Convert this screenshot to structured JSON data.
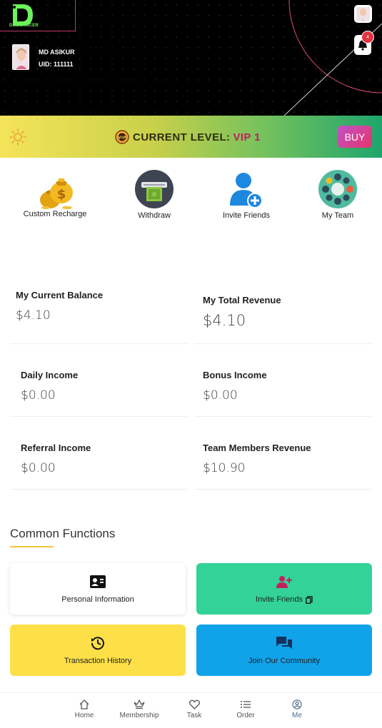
{
  "header": {
    "logo_text": "DUOLANCER",
    "user_name": "MD ASIKUR",
    "user_uid": "UID: 111111",
    "notification_count": "4"
  },
  "level": {
    "label": "CURRENT LEVEL:",
    "value": "VIP 1",
    "buy_label": "BUY",
    "colors": {
      "bar_start": "#f5e45a",
      "bar_end": "#1ea56c",
      "vip_text": "#c0215d",
      "buy_start": "#c052c9",
      "buy_end": "#e6356a"
    }
  },
  "quick_actions": [
    {
      "label": "Custom Recharge",
      "icon": "money-bags-icon"
    },
    {
      "label": "Withdraw",
      "icon": "cash-machine-icon"
    },
    {
      "label": "Invite Friends",
      "icon": "add-user-icon"
    },
    {
      "label": "My Team",
      "icon": "team-table-icon"
    }
  ],
  "stats": [
    {
      "label": "My Current Balance",
      "value": "$4.10"
    },
    {
      "label": "My Total Revenue",
      "value": "$4.10"
    },
    {
      "label": "Daily Income",
      "value": "$0.00"
    },
    {
      "label": "Bonus Income",
      "value": "$0.00"
    },
    {
      "label": "Referral Income",
      "value": "$0.00"
    },
    {
      "label": "Team Members Revenue",
      "value": "$10.90"
    }
  ],
  "common_functions": {
    "title": "Common Functions",
    "items": [
      {
        "label": "Personal Information",
        "icon": "id-card-icon",
        "color": "#ffffff"
      },
      {
        "label": "Invite Friends",
        "icon": "add-user-icon",
        "color": "#33d298"
      },
      {
        "label": "Transaction History",
        "icon": "history-icon",
        "color": "#fde047"
      },
      {
        "label": "Join Our Community",
        "icon": "chat-icon",
        "color": "#10a3ea"
      }
    ]
  },
  "nav": [
    {
      "label": "Home",
      "icon": "home-icon"
    },
    {
      "label": "Membership",
      "icon": "crown-icon"
    },
    {
      "label": "Task",
      "icon": "heart-icon"
    },
    {
      "label": "Order",
      "icon": "list-icon"
    },
    {
      "label": "Me",
      "icon": "user-circle-icon",
      "active": true
    }
  ]
}
